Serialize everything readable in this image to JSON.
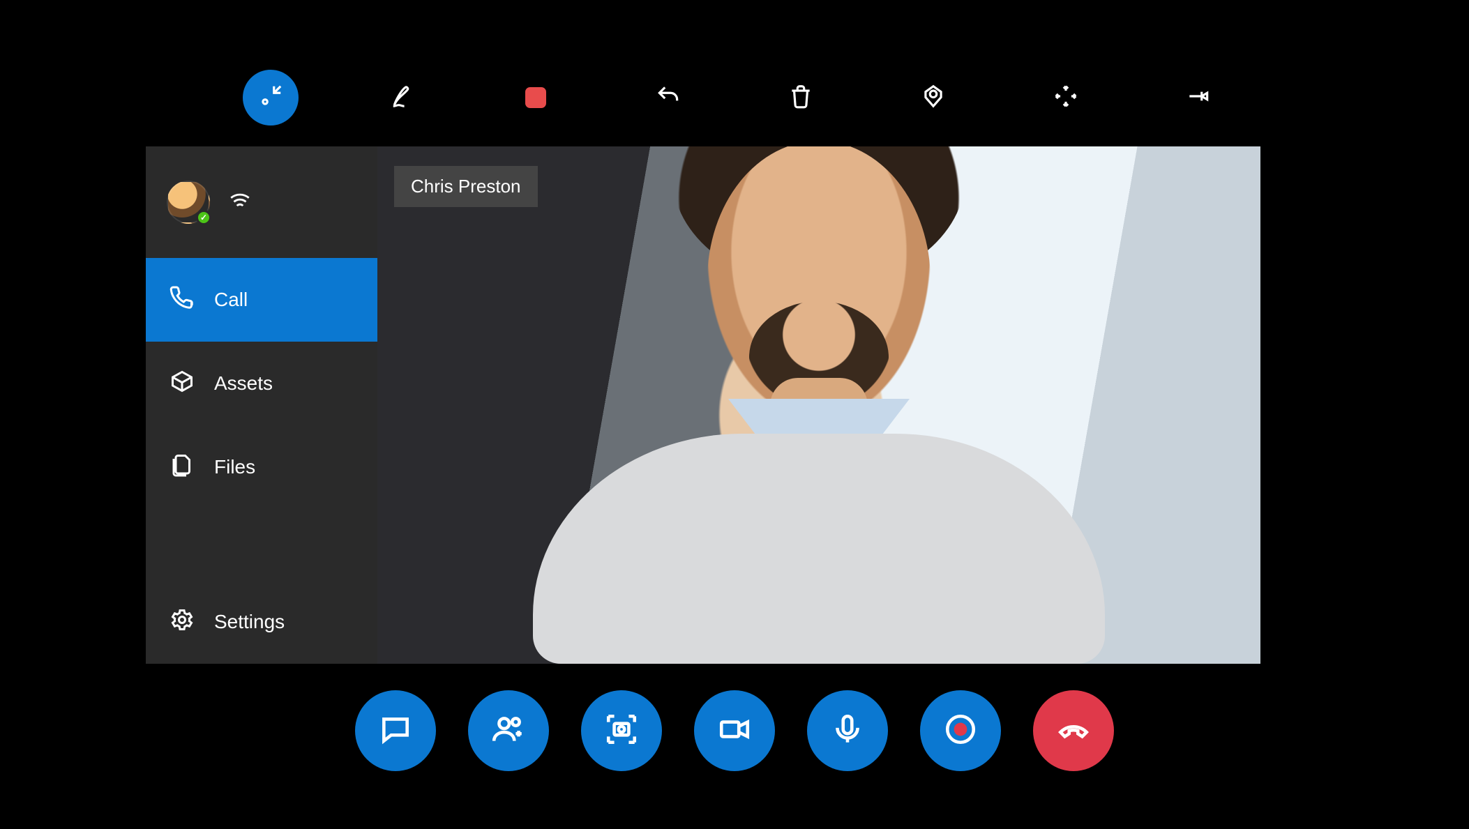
{
  "participant": {
    "name": "Chris Preston"
  },
  "sidebar": {
    "items": [
      {
        "id": "call",
        "label": "Call",
        "icon": "phone-icon"
      },
      {
        "id": "assets",
        "label": "Assets",
        "icon": "package-icon"
      },
      {
        "id": "files",
        "label": "Files",
        "icon": "files-icon"
      },
      {
        "id": "settings",
        "label": "Settings",
        "icon": "gear-icon"
      }
    ],
    "active": "call"
  },
  "top_toolbar": {
    "buttons": [
      {
        "id": "minimize",
        "icon": "minimize-icon",
        "active": true
      },
      {
        "id": "ink",
        "icon": "pen-icon"
      },
      {
        "id": "color",
        "icon": "color-square-icon",
        "color": "#e84c4c"
      },
      {
        "id": "undo",
        "icon": "undo-icon"
      },
      {
        "id": "delete",
        "icon": "trash-icon"
      },
      {
        "id": "place",
        "icon": "place-marker-icon"
      },
      {
        "id": "expand",
        "icon": "expand-arrows-icon"
      },
      {
        "id": "pin",
        "icon": "pin-icon"
      }
    ]
  },
  "call_bar": {
    "buttons": [
      {
        "id": "chat",
        "icon": "chat-icon"
      },
      {
        "id": "add-person",
        "icon": "add-person-icon"
      },
      {
        "id": "snapshot",
        "icon": "camera-capture-icon"
      },
      {
        "id": "video",
        "icon": "video-camera-icon"
      },
      {
        "id": "mic",
        "icon": "microphone-icon"
      },
      {
        "id": "record",
        "icon": "record-icon"
      },
      {
        "id": "hangup",
        "icon": "hangup-icon",
        "style": "red"
      }
    ]
  },
  "presence": {
    "status": "available"
  },
  "colors": {
    "accent": "#0b78d1",
    "danger": "#e0394a",
    "ink_swatch": "#e84c4c"
  }
}
